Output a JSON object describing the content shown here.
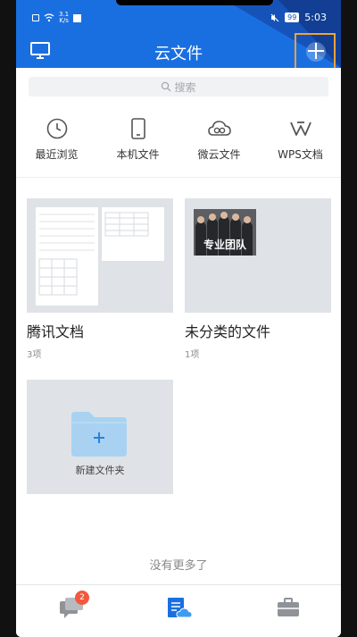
{
  "status_bar": {
    "network_speed": "3.1\nK/s",
    "battery": "99",
    "time": "5:03"
  },
  "header": {
    "title": "云文件"
  },
  "search": {
    "placeholder": "搜索"
  },
  "quick_access": [
    {
      "label": "最近浏览",
      "icon": "clock-icon"
    },
    {
      "label": "本机文件",
      "icon": "phone-icon"
    },
    {
      "label": "微云文件",
      "icon": "cloud-icon"
    },
    {
      "label": "WPS文档",
      "icon": "wps-icon"
    }
  ],
  "folders": [
    {
      "name": "腾讯文档",
      "count": "3项"
    },
    {
      "name": "未分类的文件",
      "count": "1项",
      "thumbnail_text": "专业团队"
    }
  ],
  "new_folder": {
    "label": "新建文件夹"
  },
  "footer_text": "没有更多了",
  "bottom_nav": {
    "messages_badge": "2"
  },
  "colors": {
    "header_blue": "#1a6fe0",
    "highlight_orange": "#f0a23a",
    "folder_blue": "#a9d2f2",
    "badge_red": "#f2583e"
  }
}
